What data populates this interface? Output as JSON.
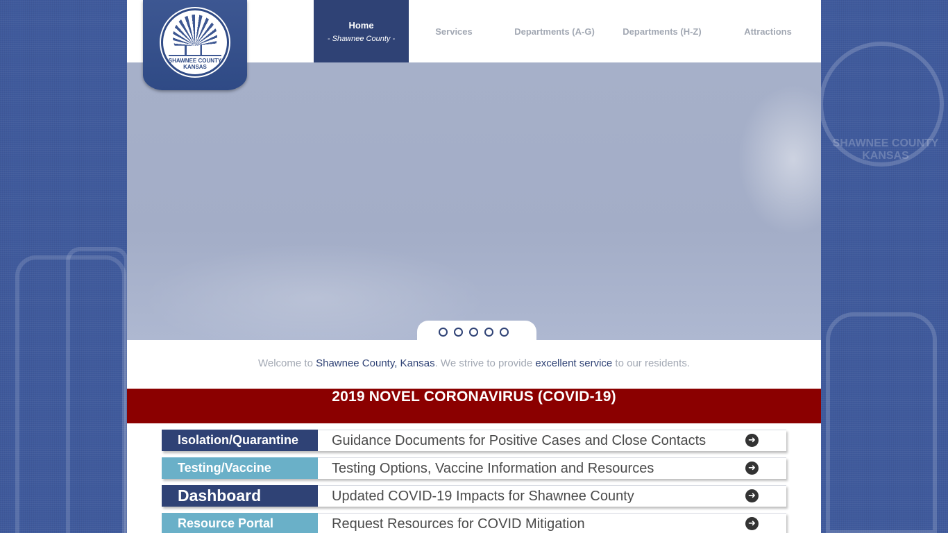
{
  "header": {
    "logo_text_line1": "SHAWNEE COUNTY",
    "logo_text_line2": "KANSAS",
    "nav": [
      {
        "label": "Home",
        "sub": "- Shawnee County -"
      },
      {
        "label": "Services"
      },
      {
        "label": "Departments (A-G)"
      },
      {
        "label": "Departments (H-Z)"
      },
      {
        "label": "Attractions"
      }
    ]
  },
  "hero": {
    "slide_count": 5
  },
  "welcome": {
    "part1": "Welcome to ",
    "county": "Shawnee County, Kansas",
    "part2": ". We strive to provide ",
    "service": "excellent service",
    "part3": " to our residents."
  },
  "covid": {
    "title": "2019 NOVEL CORONAVIRUS (COVID-19)",
    "rows": [
      {
        "tag": "Isolation/Quarantine",
        "desc": "Guidance Documents for Positive Cases and Close Contacts"
      },
      {
        "tag": "Testing/Vaccine",
        "desc": "Testing Options, Vaccine Information and Resources"
      },
      {
        "tag": "Dashboard",
        "desc": "Updated COVID-19 Impacts for Shawnee County"
      },
      {
        "tag": "Resource Portal",
        "desc": "Request Resources for COVID Mitigation"
      }
    ]
  },
  "background": {
    "seal_text": "SHAWNEE COUNTY KANSAS"
  },
  "colors": {
    "navy": "#2f4275",
    "covid_red": "#8b0000",
    "light_blue": "#6ab0c8",
    "background_blue": "#3f5a9c"
  }
}
